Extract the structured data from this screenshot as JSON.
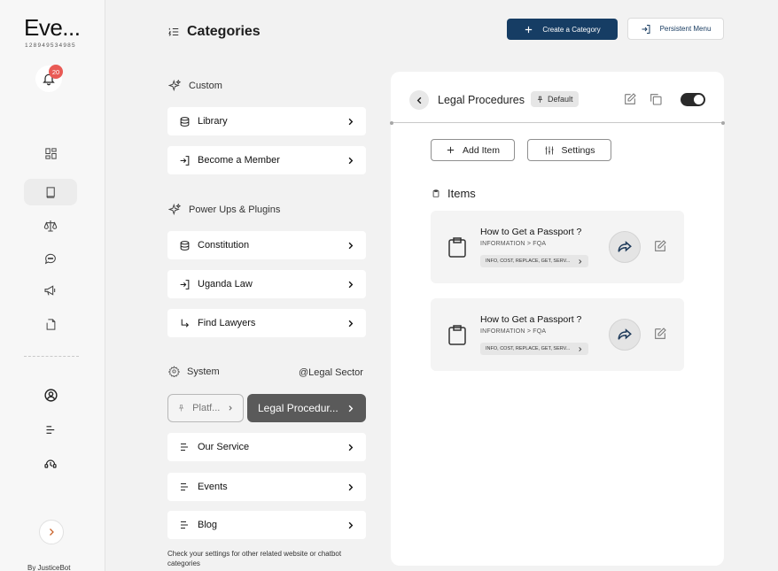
{
  "sidebar": {
    "brand": "Eve...",
    "brand_id": "128949534985",
    "notifications_count": "20",
    "nav_icons": [
      "dashboard-icon",
      "book-icon",
      "scales-icon",
      "chat-icon",
      "megaphone-icon",
      "document-icon",
      "user-circle-icon",
      "list-icon",
      "support-icon"
    ],
    "footer": "By JusticeBot"
  },
  "header": {
    "title": "Categories",
    "create_label": "Create a Category",
    "persistent_label": "Persistent Menu"
  },
  "sections": {
    "custom": {
      "label": "Custom",
      "items": [
        {
          "label": "Library",
          "icon": "database-icon"
        },
        {
          "label": "Become a Member",
          "icon": "login-icon"
        }
      ]
    },
    "powerups": {
      "label": "Power Ups & Plugins",
      "items": [
        {
          "label": "Constitution",
          "icon": "database-icon"
        },
        {
          "label": "Uganda Law",
          "icon": "login-icon"
        },
        {
          "label": "Find Lawyers",
          "icon": "corner-arrow-icon"
        }
      ]
    },
    "system": {
      "label": "System",
      "right_label": "@Legal Sector",
      "chip_plat": "Platf...",
      "chip_legal": "Legal Procedur...",
      "items": [
        {
          "label": "Our Service",
          "icon": "menu-lines-icon"
        },
        {
          "label": "Events",
          "icon": "menu-lines-icon"
        },
        {
          "label": "Blog",
          "icon": "menu-lines-icon"
        }
      ]
    },
    "help_text": "Check your settings for other related website or chatbot categories"
  },
  "panel": {
    "title": "Legal Procedures",
    "badge": "Default",
    "toggle_on": true,
    "add_item_label": "Add Item",
    "settings_label": "Settings",
    "items_heading": "Items",
    "items": [
      {
        "title": "How to Get a Passport ?",
        "path": "INFORMATION > FQA",
        "tags": "INFO, COST, REPLACE, GET,  SERV..."
      },
      {
        "title": "How to Get a Passport ?",
        "path": "INFORMATION > FQA",
        "tags": "INFO, COST, REPLACE, GET,  SERV..."
      }
    ]
  },
  "colors": {
    "primary": "#163d64",
    "badge": "#e95a55",
    "active_chip": "#5a5a5a"
  }
}
